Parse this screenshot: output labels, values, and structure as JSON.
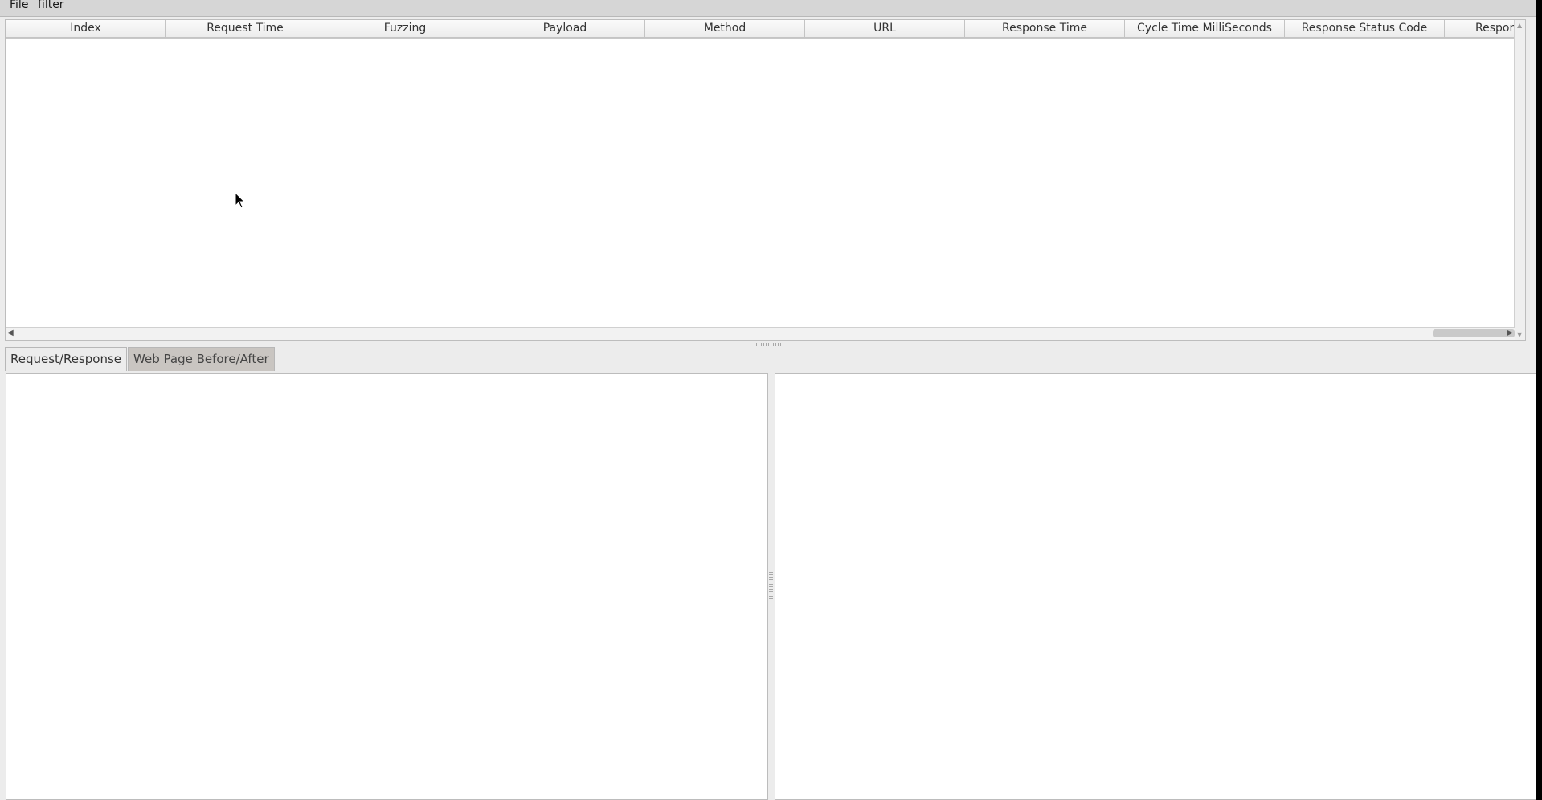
{
  "menu": {
    "file": "File",
    "filter": "filter"
  },
  "table": {
    "columns": [
      "Index",
      "Request Time",
      "Fuzzing",
      "Payload",
      "Method",
      "URL",
      "Response Time",
      "Cycle Time MilliSeconds",
      "Response Status Code",
      "Respon:"
    ],
    "rows": []
  },
  "tabs": {
    "request_response": "Request/Response",
    "web_page": "Web Page Before/After",
    "selected": "Request/Response"
  },
  "panes": {
    "left_content": "",
    "right_content": ""
  }
}
